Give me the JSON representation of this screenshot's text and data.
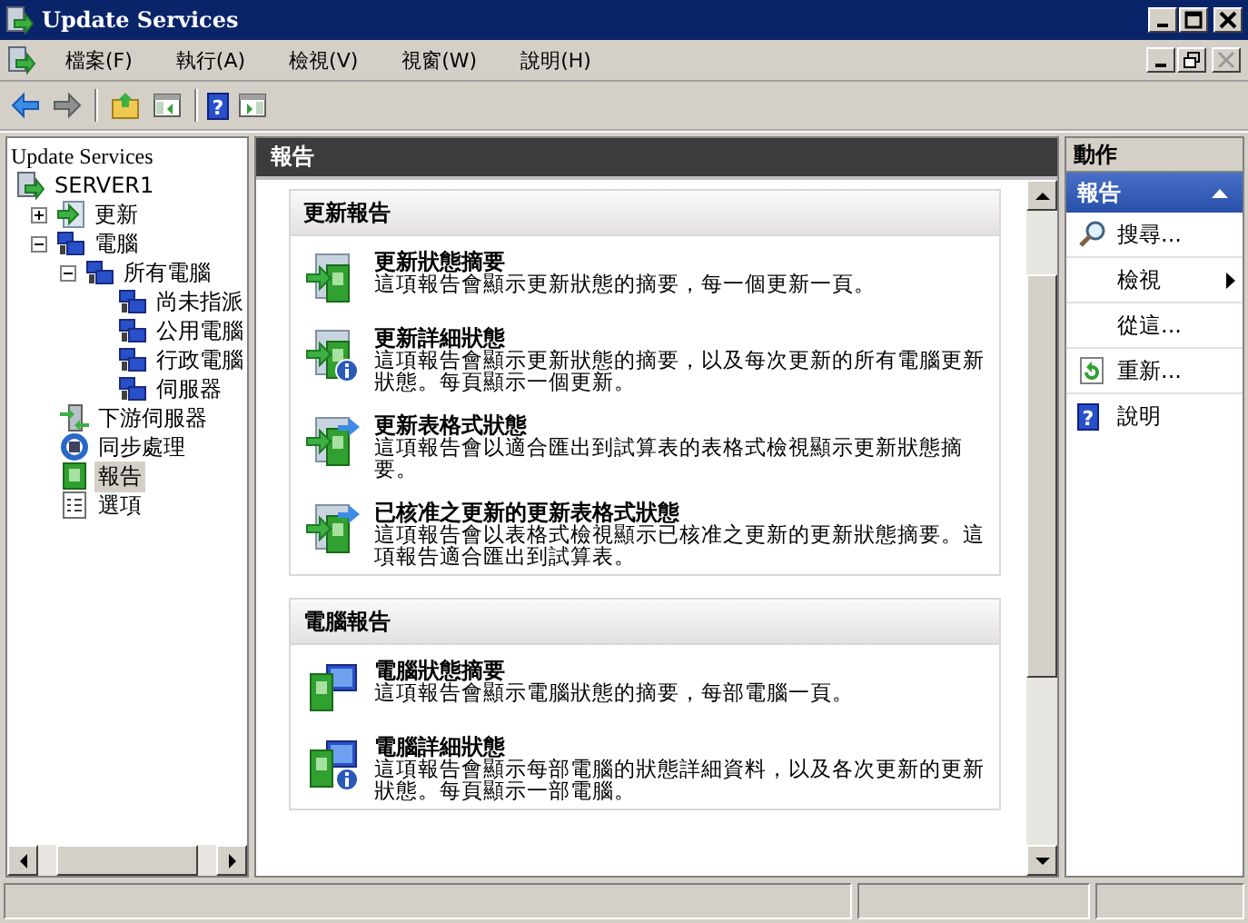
{
  "window": {
    "title": "Update Services"
  },
  "menu": [
    "檔案(F)",
    "執行(A)",
    "檢視(V)",
    "視窗(W)",
    "說明(H)"
  ],
  "toolbar": {
    "help_glyph": "?"
  },
  "tree": {
    "header": "Update Services",
    "items": [
      {
        "label": "SERVER1",
        "kind": "server",
        "selected": false,
        "children": [
          {
            "label": "更新",
            "kind": "updates",
            "expanded": false,
            "selected": false
          },
          {
            "label": "電腦",
            "kind": "computers",
            "expanded": true,
            "selected": false,
            "children": [
              {
                "label": "所有電腦",
                "kind": "computers",
                "expanded": true,
                "selected": false,
                "children": [
                  {
                    "label": "尚未指派",
                    "kind": "computers",
                    "selected": false
                  },
                  {
                    "label": "公用電腦",
                    "kind": "computers",
                    "selected": false
                  },
                  {
                    "label": "行政電腦",
                    "kind": "computers",
                    "selected": false
                  },
                  {
                    "label": "伺服器",
                    "kind": "computers",
                    "selected": false
                  }
                ]
              }
            ]
          },
          {
            "label": "下游伺服器",
            "kind": "downstream",
            "selected": false
          },
          {
            "label": "同步處理",
            "kind": "sync",
            "selected": false
          },
          {
            "label": "報告",
            "kind": "reports",
            "selected": true
          },
          {
            "label": "選項",
            "kind": "options",
            "selected": false
          }
        ]
      }
    ]
  },
  "center": {
    "title": "報告",
    "sections": [
      {
        "title": "更新報告",
        "kind": "update",
        "reports": [
          {
            "kind": "summary",
            "title": "更新狀態摘要",
            "description": "這項報告會顯示更新狀態的摘要，每一個更新一頁。"
          },
          {
            "kind": "detail",
            "title": "更新詳細狀態",
            "description": "這項報告會顯示更新狀態的摘要，以及每次更新的所有電腦更新狀態。每頁顯示一個更新。"
          },
          {
            "kind": "tabular",
            "title": "更新表格式狀態",
            "description": "這項報告會以適合匯出到試算表的表格式檢視顯示更新狀態摘要。"
          },
          {
            "kind": "tabular",
            "title": "已核准之更新的更新表格式狀態",
            "description": "這項報告會以表格式檢視顯示已核准之更新的更新狀態摘要。這項報告適合匯出到試算表。"
          }
        ]
      },
      {
        "title": "電腦報告",
        "kind": "computer",
        "reports": [
          {
            "kind": "summary",
            "title": "電腦狀態摘要",
            "description": "這項報告會顯示電腦狀態的摘要，每部電腦一頁。"
          },
          {
            "kind": "detail",
            "title": "電腦詳細狀態",
            "description": "這項報告會顯示每部電腦的狀態詳細資料，以及各次更新的更新狀態。每頁顯示一部電腦。"
          }
        ]
      }
    ]
  },
  "actions": {
    "title": "動作",
    "group": {
      "title": "報告",
      "expanded": true
    },
    "items": [
      {
        "kind": "search",
        "label": "搜尋..."
      },
      {
        "kind": "submenu",
        "label": "檢視"
      },
      {
        "kind": "plain",
        "label": "從這..."
      },
      {
        "kind": "refresh",
        "label": "重新..."
      },
      {
        "kind": "help",
        "label": "說明",
        "glyph": "?"
      }
    ]
  }
}
